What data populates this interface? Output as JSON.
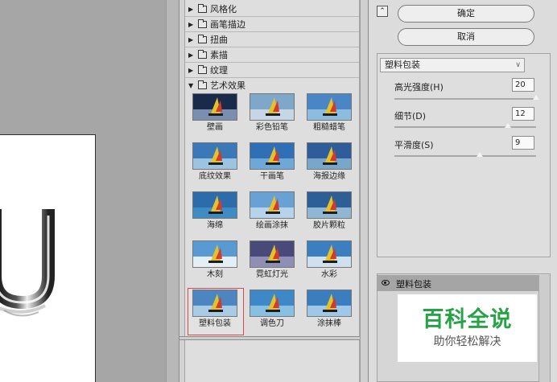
{
  "gallery": {
    "categories": [
      {
        "label": "风格化",
        "open": false
      },
      {
        "label": "画笔描边",
        "open": false
      },
      {
        "label": "扭曲",
        "open": false
      },
      {
        "label": "素描",
        "open": false
      },
      {
        "label": "纹理",
        "open": false
      },
      {
        "label": "艺术效果",
        "open": true
      }
    ],
    "thumbnails": [
      {
        "label": "壁画"
      },
      {
        "label": "彩色铅笔"
      },
      {
        "label": "粗糙蜡笔"
      },
      {
        "label": "底纹效果"
      },
      {
        "label": "干画笔"
      },
      {
        "label": "海报边缘"
      },
      {
        "label": "海绵"
      },
      {
        "label": "绘画涂抹"
      },
      {
        "label": "胶片颗粒"
      },
      {
        "label": "木刻"
      },
      {
        "label": "霓虹灯光"
      },
      {
        "label": "水彩"
      },
      {
        "label": "塑料包装"
      },
      {
        "label": "调色刀"
      },
      {
        "label": "涂抹棒"
      }
    ],
    "selected": "塑料包装",
    "selection_color": "#d24a4a"
  },
  "settings": {
    "ok_label": "确定",
    "cancel_label": "取消",
    "filter_select": "塑料包装",
    "params": [
      {
        "label": "高光强度(H)",
        "value": "20",
        "level": 1.0
      },
      {
        "label": "细节(D)",
        "value": "12",
        "level": 0.8
      },
      {
        "label": "平滑度(S)",
        "value": "9",
        "level": 0.6
      }
    ]
  },
  "layers": {
    "items": [
      {
        "label": "塑料包装"
      }
    ]
  },
  "watermark": {
    "title": "百科全说",
    "subtitle": "助你轻松解决",
    "accent": "#25a346"
  },
  "preview": {
    "glyph": "U"
  }
}
